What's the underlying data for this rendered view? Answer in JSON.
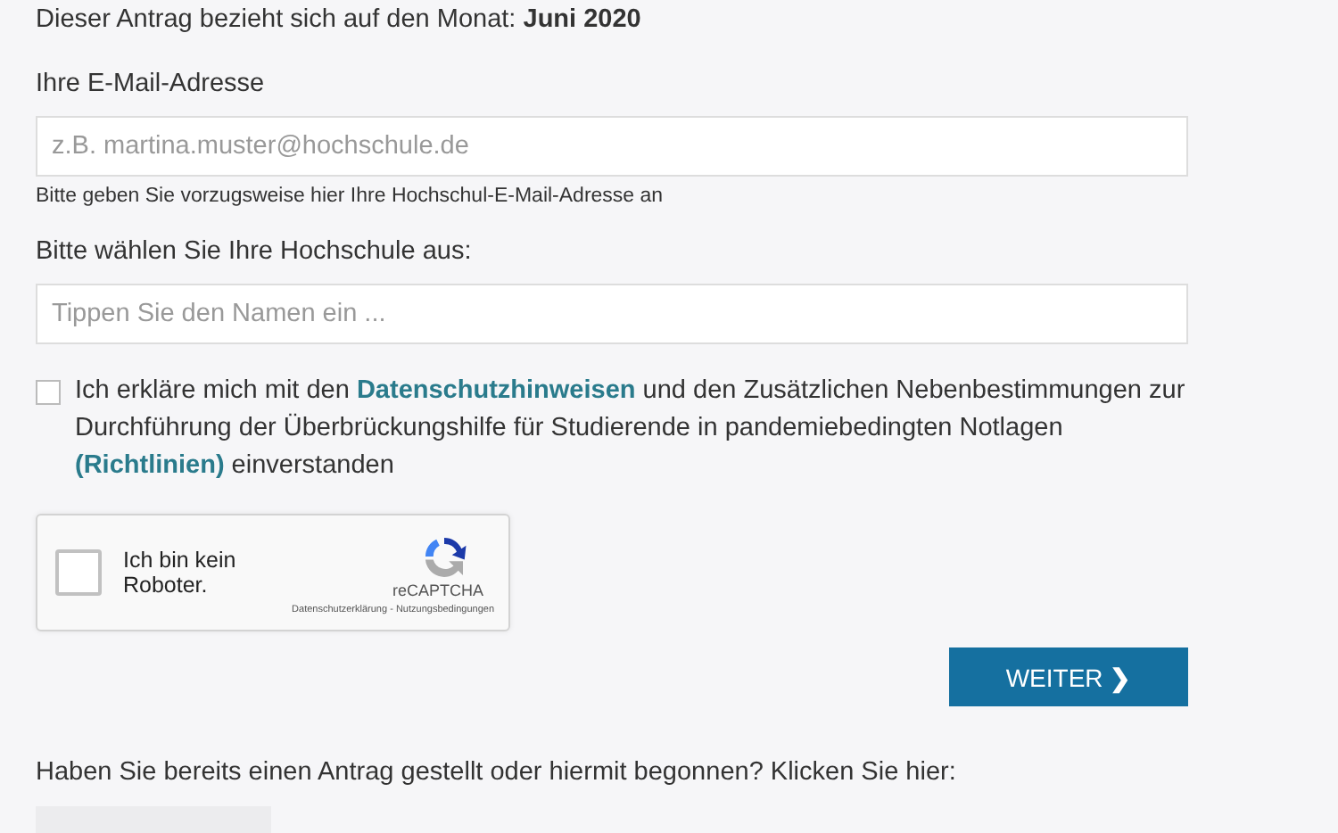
{
  "intro": "Dieser Antrag bezieht sich auf den Monat: **Juni 2020**",
  "email": {
    "label": "Ihre E-Mail-Adresse",
    "placeholder": "z.B. martina.muster@hochschule.de",
    "hint": "Bitte geben Sie vorzugsweise hier Ihre Hochschul-E-Mail-Adresse an"
  },
  "university": {
    "label": "Bitte wählen Sie Ihre Hochschule aus:",
    "placeholder": "Tippen Sie den Namen ein ..."
  },
  "consent": {
    "checked": false,
    "segments": [
      {
        "kind": "text",
        "text": "Ich erkläre mich mit den "
      },
      {
        "kind": "link",
        "text": "Datenschutzhinweisen"
      },
      {
        "kind": "text",
        "text": " und den Zusätzlichen Nebenbestimmungen zur Durchführung der Überbrückungshilfe für Studierende in pandemiebedingten Notlagen "
      },
      {
        "kind": "link",
        "text": "(Richtlinien)"
      },
      {
        "kind": "text",
        "text": " einverstanden"
      }
    ]
  },
  "captcha": {
    "checked": false,
    "label": "Ich bin kein Roboter.",
    "brand": "reCAPTCHA",
    "privacy": "Datenschutzerklärung",
    "separator": " - ",
    "terms": "Nutzungsbedingungen"
  },
  "next_button": {
    "label": "WEITER",
    "icon": "❯"
  },
  "footer": {
    "text": "Haben Sie bereits einen Antrag gestellt oder hiermit begonnen? Klicken Sie hier:"
  }
}
